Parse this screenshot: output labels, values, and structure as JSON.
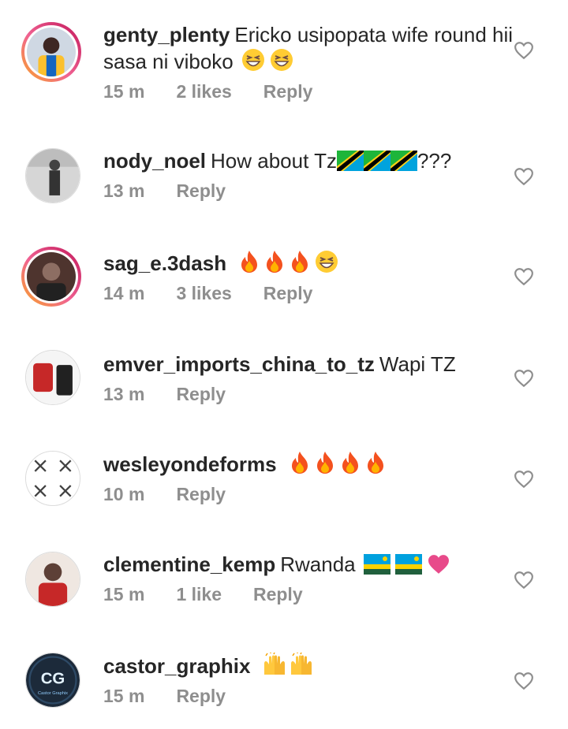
{
  "comments": [
    {
      "username": "genty_plenty",
      "text": "Ericko usipopata wife round hii sasa ni viboko",
      "emojis": [
        "grinning-squinting-face",
        "grinning-squinting-face"
      ],
      "time": "15 m",
      "likes": "2 likes",
      "reply": "Reply"
    },
    {
      "username": "nody_noel",
      "text": "How about Tz",
      "emojis": [
        "flag-tanzania",
        "flag-tanzania",
        "flag-tanzania"
      ],
      "suffix": "???",
      "time": "13 m",
      "likes": "",
      "reply": "Reply"
    },
    {
      "username": "sag_e.3dash",
      "text": "",
      "emojis": [
        "fire",
        "fire",
        "fire",
        "grinning-squinting-face"
      ],
      "time": "14 m",
      "likes": "3 likes",
      "reply": "Reply"
    },
    {
      "username": "emver_imports_china_to_tz",
      "text": "Wapi TZ",
      "emojis": [],
      "time": "13 m",
      "likes": "",
      "reply": "Reply"
    },
    {
      "username": "wesleyondeforms",
      "text": "",
      "emojis": [
        "fire",
        "fire",
        "fire",
        "fire"
      ],
      "time": "10 m",
      "likes": "",
      "reply": "Reply"
    },
    {
      "username": "clementine_kemp",
      "text": "Rwanda",
      "emojis": [
        "flag-rwanda",
        "flag-rwanda",
        "pink-heart"
      ],
      "time": "15 m",
      "likes": "1 like",
      "reply": "Reply"
    },
    {
      "username": "castor_graphix",
      "text": "",
      "emojis": [
        "raising-hands",
        "raising-hands"
      ],
      "time": "15 m",
      "likes": "",
      "reply": "Reply"
    }
  ],
  "avatar_logo_text": "CG",
  "avatar_logo_caption": "Castor Graphix",
  "colors": {
    "text": "#262626",
    "meta": "#8e8e8e",
    "story_ring_start": "#f9a825",
    "story_ring_end": "#c2185b"
  }
}
